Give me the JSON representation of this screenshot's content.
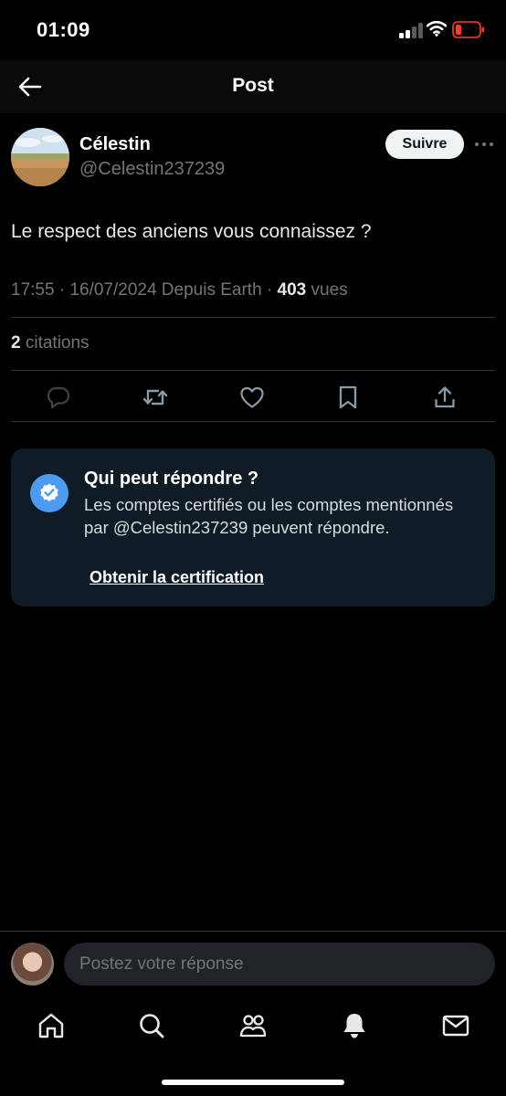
{
  "status_bar": {
    "time": "01:09"
  },
  "header": {
    "title": "Post"
  },
  "post": {
    "author_name": "Célestin",
    "author_handle": "@Celestin237239",
    "follow_label": "Suivre",
    "text": "Le respect des anciens vous connaissez ?",
    "meta_prefix": "17:55 · 16/07/2024 Depuis Earth · ",
    "views_count": "403",
    "views_label": " vues",
    "quotes_count": "2",
    "quotes_label": " citations"
  },
  "reply_restriction": {
    "title": "Qui peut répondre ?",
    "body": "Les comptes certifiés ou les comptes mentionnés par @Celestin237239 peuvent répondre.",
    "link": "Obtenir la certification"
  },
  "reply_input": {
    "placeholder": "Postez votre réponse"
  },
  "icons": {
    "back": "arrow-left-icon",
    "more": "more-horizontal-icon",
    "reply": "comment-icon",
    "repost": "repost-icon",
    "like": "heart-icon",
    "bookmark": "bookmark-icon",
    "share": "share-icon",
    "verified": "verified-check-icon",
    "home": "home-icon",
    "search": "search-icon",
    "communities": "communities-icon",
    "notifications": "bell-icon",
    "messages": "mail-icon"
  },
  "colors": {
    "background": "#000000",
    "card": "#0f1c26",
    "accent": "#4c9bf0",
    "muted_text": "#71767b",
    "battery_low": "#ff3b30"
  }
}
